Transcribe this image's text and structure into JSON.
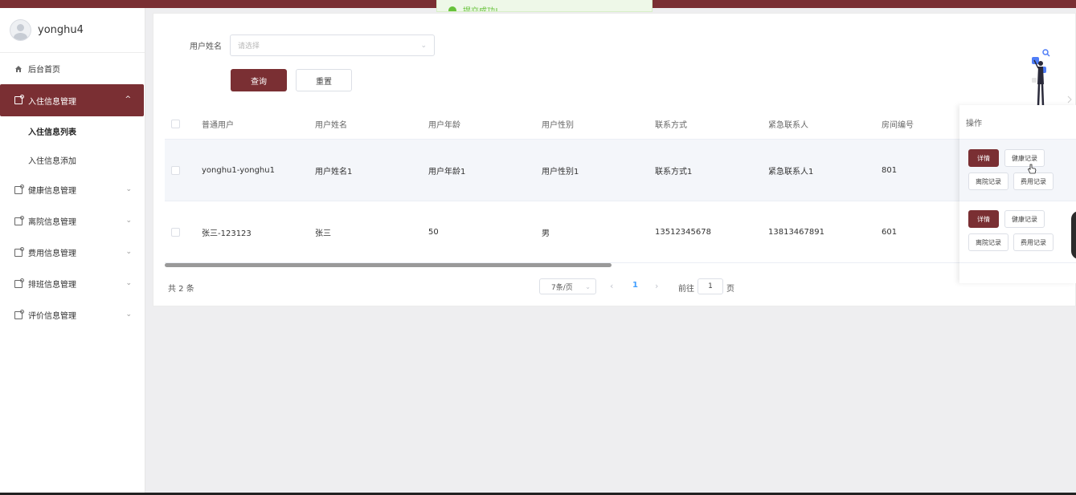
{
  "toast": {
    "message": "提交成功!"
  },
  "user": {
    "name": "yonghu4"
  },
  "sidebar": {
    "items": [
      {
        "label": "后台首页",
        "icon": "home-icon"
      },
      {
        "label": "入住信息管理",
        "icon": "folder-icon",
        "active": true,
        "children": [
          {
            "label": "入住信息列表",
            "selected": true
          },
          {
            "label": "入住信息添加"
          }
        ]
      },
      {
        "label": "健康信息管理",
        "icon": "folder-icon"
      },
      {
        "label": "离院信息管理",
        "icon": "folder-icon"
      },
      {
        "label": "费用信息管理",
        "icon": "folder-icon"
      },
      {
        "label": "排班信息管理",
        "icon": "folder-icon"
      },
      {
        "label": "评价信息管理",
        "icon": "folder-icon"
      }
    ]
  },
  "search": {
    "label": "用户姓名",
    "placeholder": "请选择",
    "query_label": "查询",
    "reset_label": "重置"
  },
  "table": {
    "columns": [
      "普通用户",
      "用户姓名",
      "用户年龄",
      "用户性别",
      "联系方式",
      "紧急联系人",
      "房间编号",
      "操作"
    ],
    "rows": [
      {
        "user": "yonghu1-yonghu1",
        "name": "用户姓名1",
        "age": "用户年龄1",
        "gender": "用户性别1",
        "phone": "联系方式1",
        "emergency": "紧急联系人1",
        "room": "801"
      },
      {
        "user": "张三-123123",
        "name": "张三",
        "age": "50",
        "gender": "男",
        "phone": "13512345678",
        "emergency": "13813467891",
        "room": "601"
      }
    ],
    "actions": {
      "detail": "详情",
      "health": "健康记录",
      "leave": "离院记录",
      "fee": "费用记录"
    }
  },
  "pagination": {
    "total": "共 2 条",
    "page_size": "7条/页",
    "current": "1",
    "goto_label": "前往",
    "goto_value": "1",
    "goto_suffix": "页"
  },
  "colors": {
    "brand": "#7a2f33",
    "success": "#67c23a",
    "link": "#409eff"
  }
}
